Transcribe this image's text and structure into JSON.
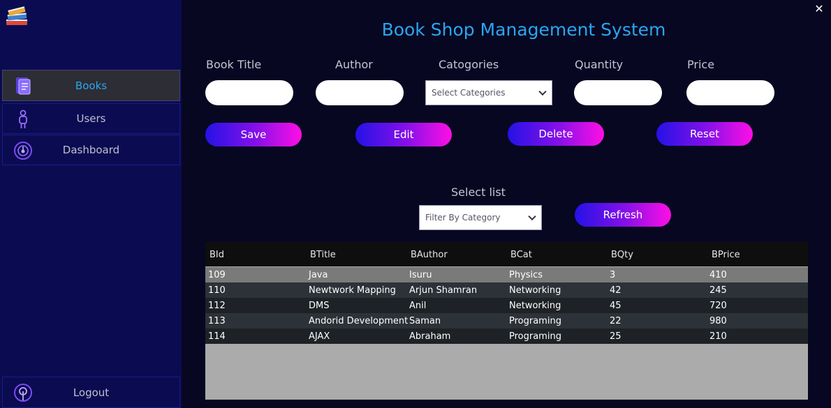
{
  "window": {
    "close_glyph": "✕"
  },
  "title": "Book Shop Management System",
  "sidebar": {
    "items": [
      {
        "label": "Books",
        "icon": "book-icon",
        "active": true
      },
      {
        "label": "Users",
        "icon": "user-icon",
        "active": false
      },
      {
        "label": "Dashboard",
        "icon": "dashboard-icon",
        "active": false
      }
    ],
    "logout": {
      "label": "Logout",
      "icon": "logout-icon"
    }
  },
  "form": {
    "labels": {
      "book_title": "Book Title",
      "author": "Author",
      "categories": "Catogories",
      "quantity": "Quantity",
      "price": "Price"
    },
    "values": {
      "book_title": "",
      "author": "",
      "quantity": "",
      "price": ""
    },
    "category_select": "Select Categories"
  },
  "buttons": {
    "save": "Save",
    "edit": "Edit",
    "delete": "Delete",
    "reset": "Reset",
    "refresh": "Refresh"
  },
  "filter": {
    "label": "Select list",
    "select": "Filter By Category"
  },
  "table": {
    "columns": [
      "BId",
      "BTitle",
      "BAuthor",
      "BCat",
      "BQty",
      "BPrice"
    ],
    "rows": [
      [
        "109",
        "Java",
        "Isuru",
        "Physics",
        "3",
        "410"
      ],
      [
        "110",
        "Newtwork Mapping",
        "Arjun Shamran",
        "Networking",
        "42",
        "245"
      ],
      [
        "112",
        "DMS",
        "Anil",
        "Networking",
        "45",
        "720"
      ],
      [
        "113",
        "Andorid Development",
        "Saman",
        "Programing",
        "22",
        "980"
      ],
      [
        "114",
        "AJAX",
        "Abraham",
        "Programing",
        "25",
        "210"
      ]
    ],
    "selected_row": 0
  },
  "colors": {
    "accent": "#2aa6ee",
    "sidebar_bg": "#0b0b52",
    "main_bg": "#070722",
    "button_gradient_start": "#2412e6",
    "button_gradient_end": "#ff0fe4"
  }
}
